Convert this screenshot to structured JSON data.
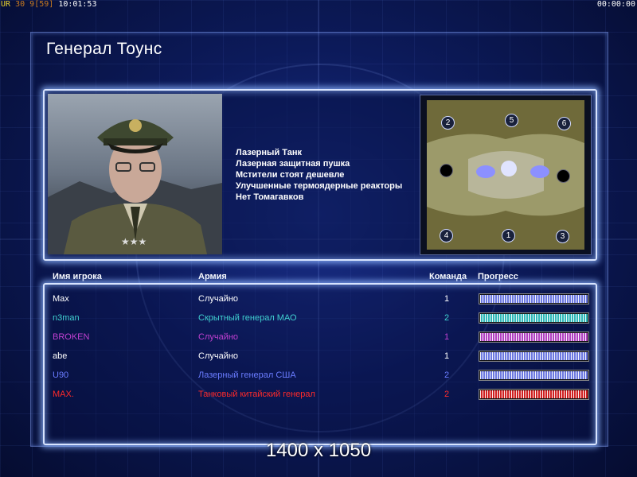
{
  "topbar": {
    "left_a": "UR",
    "left_b": "30",
    "left_c": "9",
    "left_d": "[59]",
    "clock": "10:01:53",
    "timer": "00:00:00"
  },
  "title": "Генерал Тоунс",
  "traits": [
    "Лазерный Танк",
    "Лазерная защитная пушка",
    "Мстители стоят дешевле",
    "Улучшенные термоядерные реакторы",
    "Нет Томагавков"
  ],
  "minimap": {
    "spots": [
      {
        "label": "2",
        "kind": "numbered"
      },
      {
        "label": "5",
        "kind": "numbered"
      },
      {
        "label": "6",
        "kind": "numbered"
      },
      {
        "label": "",
        "kind": "empty"
      },
      {
        "label": "",
        "kind": "empty"
      },
      {
        "label": "4",
        "kind": "numbered"
      },
      {
        "label": "1",
        "kind": "numbered"
      },
      {
        "label": "3",
        "kind": "numbered"
      }
    ]
  },
  "columns": {
    "name": "Имя игрока",
    "army": "Армия",
    "team": "Команда",
    "progress": "Прогресс"
  },
  "players": [
    {
      "name": "Max",
      "army": "Случайно",
      "team": "1",
      "color": "#ffffff",
      "bar_color": "#6c78e0",
      "progress": 1.0
    },
    {
      "name": "n3man",
      "army": "Скрытный генерал МАО",
      "team": "2",
      "color": "#40d0d0",
      "bar_color": "#30b8b8",
      "progress": 1.0
    },
    {
      "name": "BROKEN",
      "army": "Случайно",
      "team": "1",
      "color": "#c040d0",
      "bar_color": "#b040c0",
      "progress": 1.0
    },
    {
      "name": "abe",
      "army": "Случайно",
      "team": "1",
      "color": "#ffffff",
      "bar_color": "#6c78e0",
      "progress": 1.0
    },
    {
      "name": "U90",
      "army": "Лазерный генерал США",
      "team": "2",
      "color": "#6a7cff",
      "bar_color": "#6c78e0",
      "progress": 1.0
    },
    {
      "name": "MAX.",
      "army": "Танковый китайский генерал",
      "team": "2",
      "color": "#ff2a2a",
      "bar_color": "#d02020",
      "progress": 1.0
    }
  ],
  "caption": "1400 x 1050"
}
